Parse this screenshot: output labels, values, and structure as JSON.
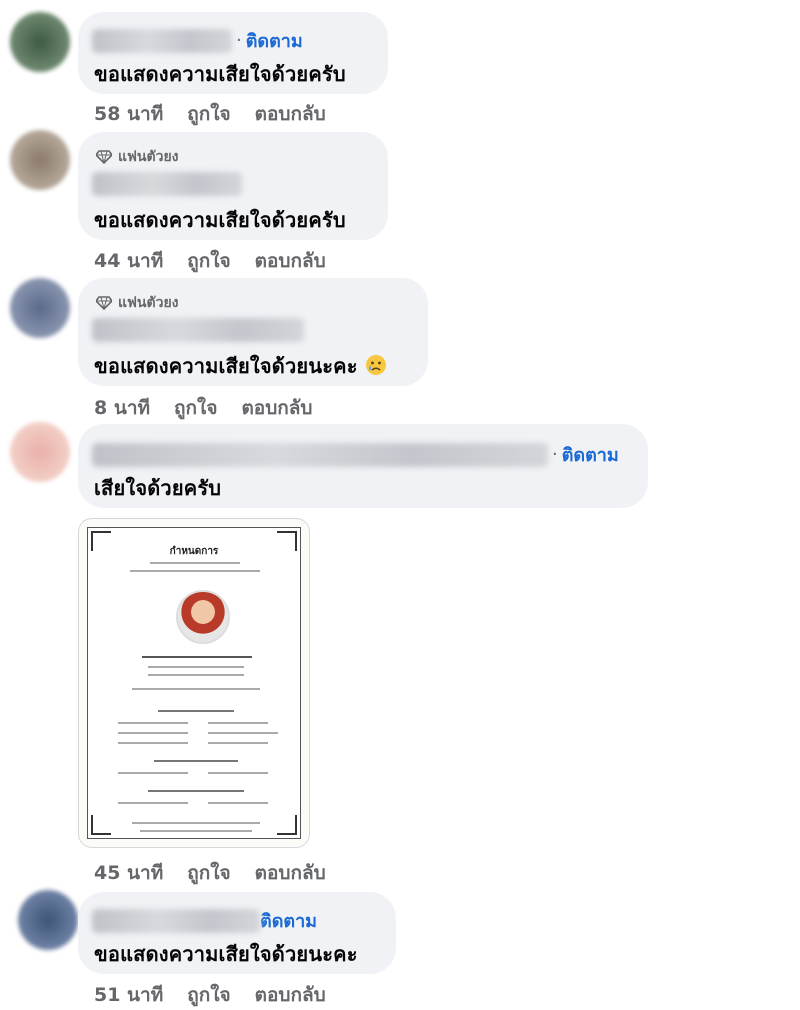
{
  "comments": [
    {
      "follow_sep": "·",
      "follow_label": "ติดตาม",
      "text": "ขอแสดงความเสียใจด้วยครับ",
      "time": "58 นาที",
      "like": "ถูกใจ",
      "reply": "ตอบกลับ"
    },
    {
      "badge": "แฟนตัวยง",
      "badge_icon": "diamond-icon",
      "text": "ขอแสดงความเสียใจด้วยครับ",
      "time": "44 นาที",
      "like": "ถูกใจ",
      "reply": "ตอบกลับ"
    },
    {
      "badge": "แฟนตัวยง",
      "badge_icon": "diamond-icon",
      "text": "ขอแสดงความเสียใจด้วยนะคะ",
      "emoji": "sad-face-emoji",
      "time": "8 นาที",
      "like": "ถูกใจ",
      "reply": "ตอบกลับ"
    },
    {
      "follow_sep": "·",
      "follow_label": "ติดตาม",
      "text": "เสียใจด้วยครับ",
      "time": "45 นาที",
      "like": "ถูกใจ",
      "reply": "ตอบกลับ"
    },
    {
      "follow_label": "ติดตาม",
      "text": "ขอแสดงความเสียใจด้วยนะคะ",
      "time": "51 นาที",
      "like": "ถูกใจ",
      "reply": "ตอบกลับ"
    }
  ],
  "attachment": {
    "title": "กำหนดการ"
  },
  "colors": {
    "link": "#1a69d4",
    "bubble": "#f0f2f5",
    "meta": "#65676b"
  }
}
